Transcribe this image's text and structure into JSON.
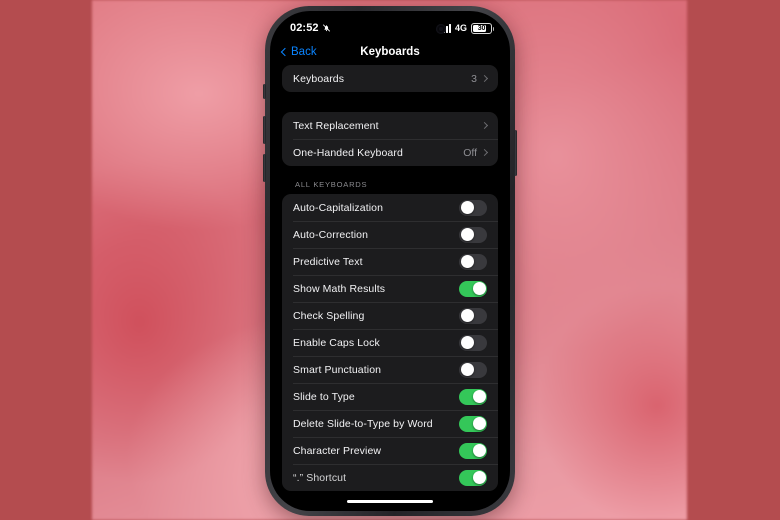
{
  "wallpaper": {
    "base_color": "#b44c4f",
    "accent_color": "#e07a83"
  },
  "status_bar": {
    "time": "02:52",
    "silent_icon": "bell-slash-icon",
    "signal_icon": "cellular-bars-icon",
    "network": "4G",
    "battery_percent": "30"
  },
  "nav_bar": {
    "back_label": "Back",
    "back_icon": "chevron-left-icon",
    "title": "Keyboards"
  },
  "colors": {
    "accent_blue": "#0a84ff",
    "toggle_on": "#34c759",
    "toggle_off": "#39393d",
    "card_bg": "#1c1c1e",
    "screen_bg": "#000000",
    "secondary_text": "#8e8e93"
  },
  "sections": [
    {
      "name": "keyboards-card",
      "header": "",
      "rows": [
        {
          "label": "Keyboards",
          "value": "3",
          "type": "disclosure"
        }
      ]
    },
    {
      "name": "text-options-card",
      "header": "",
      "rows": [
        {
          "label": "Text Replacement",
          "value": "",
          "type": "disclosure"
        },
        {
          "label": "One-Handed Keyboard",
          "value": "Off",
          "type": "disclosure"
        }
      ]
    },
    {
      "name": "all-keyboards-card",
      "header": "ALL KEYBOARDS",
      "rows": [
        {
          "label": "Auto-Capitalization",
          "value": "",
          "type": "toggle",
          "on": false
        },
        {
          "label": "Auto-Correction",
          "value": "",
          "type": "toggle",
          "on": false
        },
        {
          "label": "Predictive Text",
          "value": "",
          "type": "toggle",
          "on": false
        },
        {
          "label": "Show Math Results",
          "value": "",
          "type": "toggle",
          "on": true
        },
        {
          "label": "Check Spelling",
          "value": "",
          "type": "toggle",
          "on": false
        },
        {
          "label": "Enable Caps Lock",
          "value": "",
          "type": "toggle",
          "on": false
        },
        {
          "label": "Smart Punctuation",
          "value": "",
          "type": "toggle",
          "on": false
        },
        {
          "label": "Slide to Type",
          "value": "",
          "type": "toggle",
          "on": true
        },
        {
          "label": "Delete Slide-to-Type by Word",
          "value": "",
          "type": "toggle",
          "on": true
        },
        {
          "label": "Character Preview",
          "value": "",
          "type": "toggle",
          "on": true
        },
        {
          "label": "“.” Shortcut",
          "value": "",
          "type": "toggle",
          "on": true
        }
      ]
    }
  ]
}
